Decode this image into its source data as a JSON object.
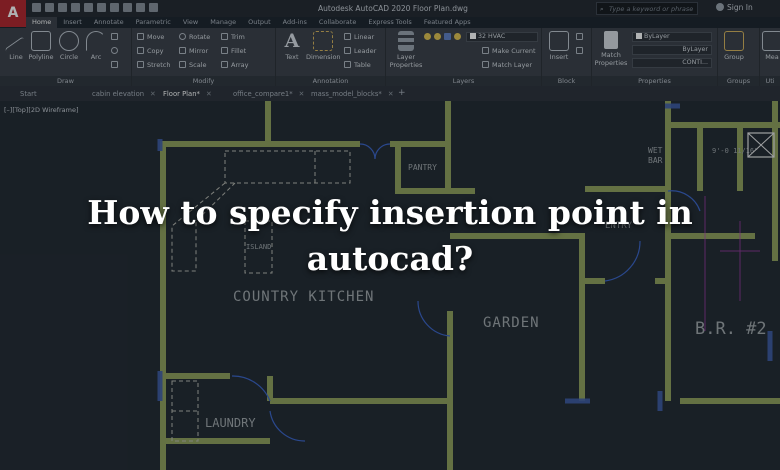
{
  "app": {
    "logo": "A",
    "window_title": "Autodesk AutoCAD 2020   Floor Plan.dwg",
    "search_placeholder": "Type a keyword or phrase",
    "sign_in": "Sign In"
  },
  "ribbon_tabs": [
    "Home",
    "Insert",
    "Annotate",
    "Parametric",
    "View",
    "Manage",
    "Output",
    "Add-ins",
    "Collaborate",
    "Express Tools",
    "Featured Apps"
  ],
  "ribbon": {
    "draw": {
      "label": "Draw",
      "tools": [
        "Line",
        "Polyline",
        "Circle",
        "Arc"
      ]
    },
    "modify": {
      "label": "Modify",
      "tools": [
        "Move",
        "Rotate",
        "Trim",
        "Copy",
        "Mirror",
        "Fillet",
        "Stretch",
        "Scale",
        "Array"
      ]
    },
    "annotation": {
      "label": "Annotation",
      "tools": [
        "Text",
        "Dimension",
        "Linear",
        "Leader",
        "Table"
      ]
    },
    "layers": {
      "label": "Layers",
      "properties": "Layer Properties",
      "current_layer": "32 HVAC",
      "make_current": "Make Current",
      "match_layer": "Match Layer"
    },
    "block": {
      "label": "Block",
      "insert": "Insert"
    },
    "properties": {
      "label": "Properties",
      "match": "Match Properties",
      "color": "ByLayer",
      "linetype": "ByLayer",
      "lineweight": "CONTI..."
    },
    "groups": {
      "label": "Groups",
      "group": "Group"
    },
    "utilities": {
      "label": "Uti",
      "measure": "Mea"
    }
  },
  "file_tabs": [
    "Start",
    "cabin elevation",
    "Floor Plan*",
    "office_compare1*",
    "mass_model_blocks*"
  ],
  "viewport": {
    "label": "[–][Top][2D Wireframe]",
    "rooms": {
      "kitchen": "COUNTRY KITCHEN",
      "island": "ISLAND",
      "pantry": "PANTRY",
      "garden": "GARDEN",
      "laundry": "LAUNDRY",
      "wet_bar_1": "WET",
      "wet_bar_2": "BAR",
      "bedroom": "B.R. #2",
      "entry": "ENTRY",
      "dimension": "9'-0 11/16\""
    }
  },
  "headline": "How to specify insertion point in autocad?"
}
